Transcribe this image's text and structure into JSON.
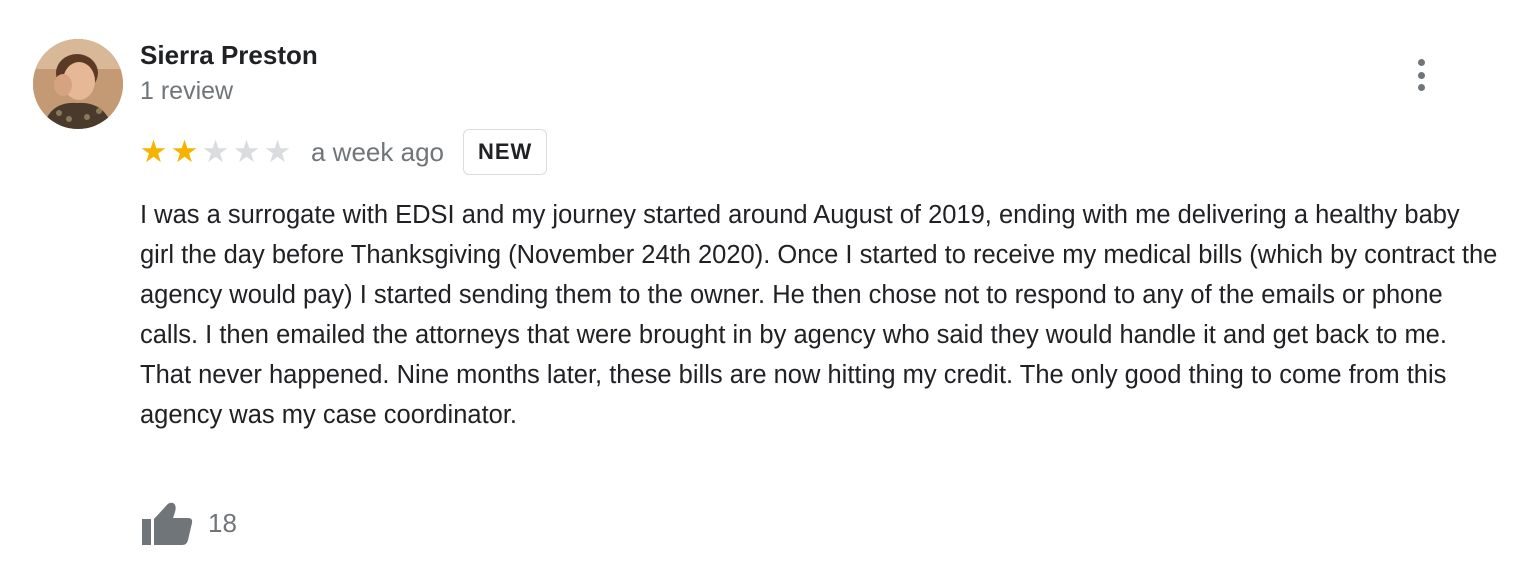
{
  "reviewer": {
    "name": "Sierra Preston",
    "review_count": "1 review"
  },
  "review": {
    "rating": 2,
    "max_rating": 5,
    "time": "a week ago",
    "badge": "NEW",
    "text": "I was a surrogate with EDSI and my journey started around August of 2019, ending with me delivering a healthy baby girl the day before Thanksgiving (November 24th 2020). Once I started to receive my medical bills (which by contract the agency would pay) I started sending them to the owner. He then chose not to respond to any of the emails or phone calls. I then emailed the attorneys that were brought in by agency who said they would handle it and get back to me. That never happened. Nine months later, these bills are now hitting my credit. The only good thing to come from this agency was my case coordinator.",
    "likes": "18"
  },
  "icons": {
    "star_filled": "star-filled-icon",
    "star_empty": "star-empty-icon",
    "menu": "more-vert-icon",
    "like": "thumbs-up-icon"
  },
  "colors": {
    "star_filled": "#f4b400",
    "star_empty": "#dadce0",
    "text_primary": "#202124",
    "text_secondary": "#70757a"
  }
}
